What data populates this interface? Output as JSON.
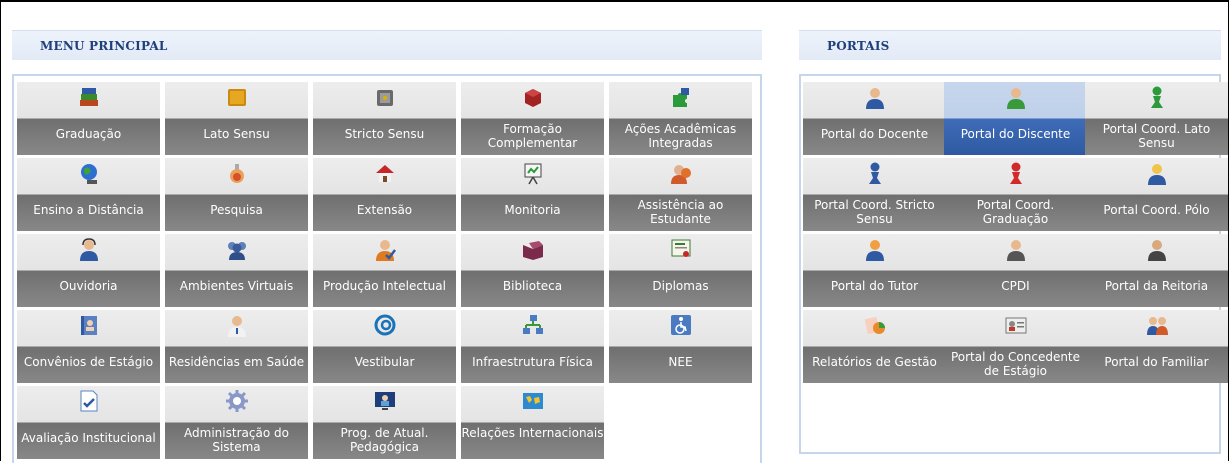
{
  "menu": {
    "title": "MENU PRINCIPAL",
    "items": [
      {
        "label": "Graduação",
        "icon": "books-icon"
      },
      {
        "label": "Lato Sensu",
        "icon": "folder-icon"
      },
      {
        "label": "Stricto Sensu",
        "icon": "safe-icon"
      },
      {
        "label": "Formação Complementar",
        "icon": "book-icon"
      },
      {
        "label": "Ações Acadêmicas Integradas",
        "icon": "puzzle-icon"
      },
      {
        "label": "Ensino a Distância",
        "icon": "globe-icon"
      },
      {
        "label": "Pesquisa",
        "icon": "flask-icon"
      },
      {
        "label": "Extensão",
        "icon": "house-icon"
      },
      {
        "label": "Monitoria",
        "icon": "presentation-board-icon"
      },
      {
        "label": "Assistência ao Estudante",
        "icon": "helper-person-icon"
      },
      {
        "label": "Ouvidoria",
        "icon": "headset-person-icon"
      },
      {
        "label": "Ambientes Virtuais",
        "icon": "users-group-icon"
      },
      {
        "label": "Produção Intelectual",
        "icon": "person-check-icon"
      },
      {
        "label": "Biblioteca",
        "icon": "open-book-icon"
      },
      {
        "label": "Diplomas",
        "icon": "certificate-icon"
      },
      {
        "label": "Convênios de Estágio",
        "icon": "address-book-icon"
      },
      {
        "label": "Residências em Saúde",
        "icon": "doctor-icon"
      },
      {
        "label": "Vestibular",
        "icon": "swirl-logo-icon"
      },
      {
        "label": "Infraestrutura Física",
        "icon": "network-icon"
      },
      {
        "label": "NEE",
        "icon": "wheelchair-icon"
      },
      {
        "label": "Avaliação Institucional",
        "icon": "checklist-icon"
      },
      {
        "label": "Administração do Sistema",
        "icon": "gear-icon"
      },
      {
        "label": "Prog. de Atual. Pedagógica",
        "icon": "monitor-person-icon"
      },
      {
        "label": "Relações Internacionais",
        "icon": "world-map-icon"
      }
    ]
  },
  "portais": {
    "title": "PORTAIS",
    "items": [
      {
        "label": "Portal do Docente",
        "icon": "teacher-icon",
        "active": false
      },
      {
        "label": "Portal do Discente",
        "icon": "student-icon",
        "active": true
      },
      {
        "label": "Portal Coord. Lato Sensu",
        "icon": "pawn-green-icon",
        "active": false
      },
      {
        "label": "Portal Coord. Stricto Sensu",
        "icon": "pawn-blue-icon",
        "active": false
      },
      {
        "label": "Portal Coord. Graduação",
        "icon": "pawn-red-icon",
        "active": false
      },
      {
        "label": "Portal Coord. Pólo",
        "icon": "person-icon",
        "active": false
      },
      {
        "label": "Portal do Tutor",
        "icon": "tutor-icon",
        "active": false
      },
      {
        "label": "CPDI",
        "icon": "manager-icon",
        "active": false
      },
      {
        "label": "Portal da Reitoria",
        "icon": "rector-icon",
        "active": false
      },
      {
        "label": "Relatórios de Gestão",
        "icon": "reports-icon",
        "active": false
      },
      {
        "label": "Portal do Concedente de Estágio",
        "icon": "id-card-icon",
        "active": false
      },
      {
        "label": "Portal do Familiar",
        "icon": "family-icon",
        "active": false
      }
    ]
  },
  "colors": {
    "header_text": "#1f3f7a",
    "tile_light": "#e4e4e4",
    "tile_dark": "#777777",
    "active_tile": "#3f6cb8"
  }
}
